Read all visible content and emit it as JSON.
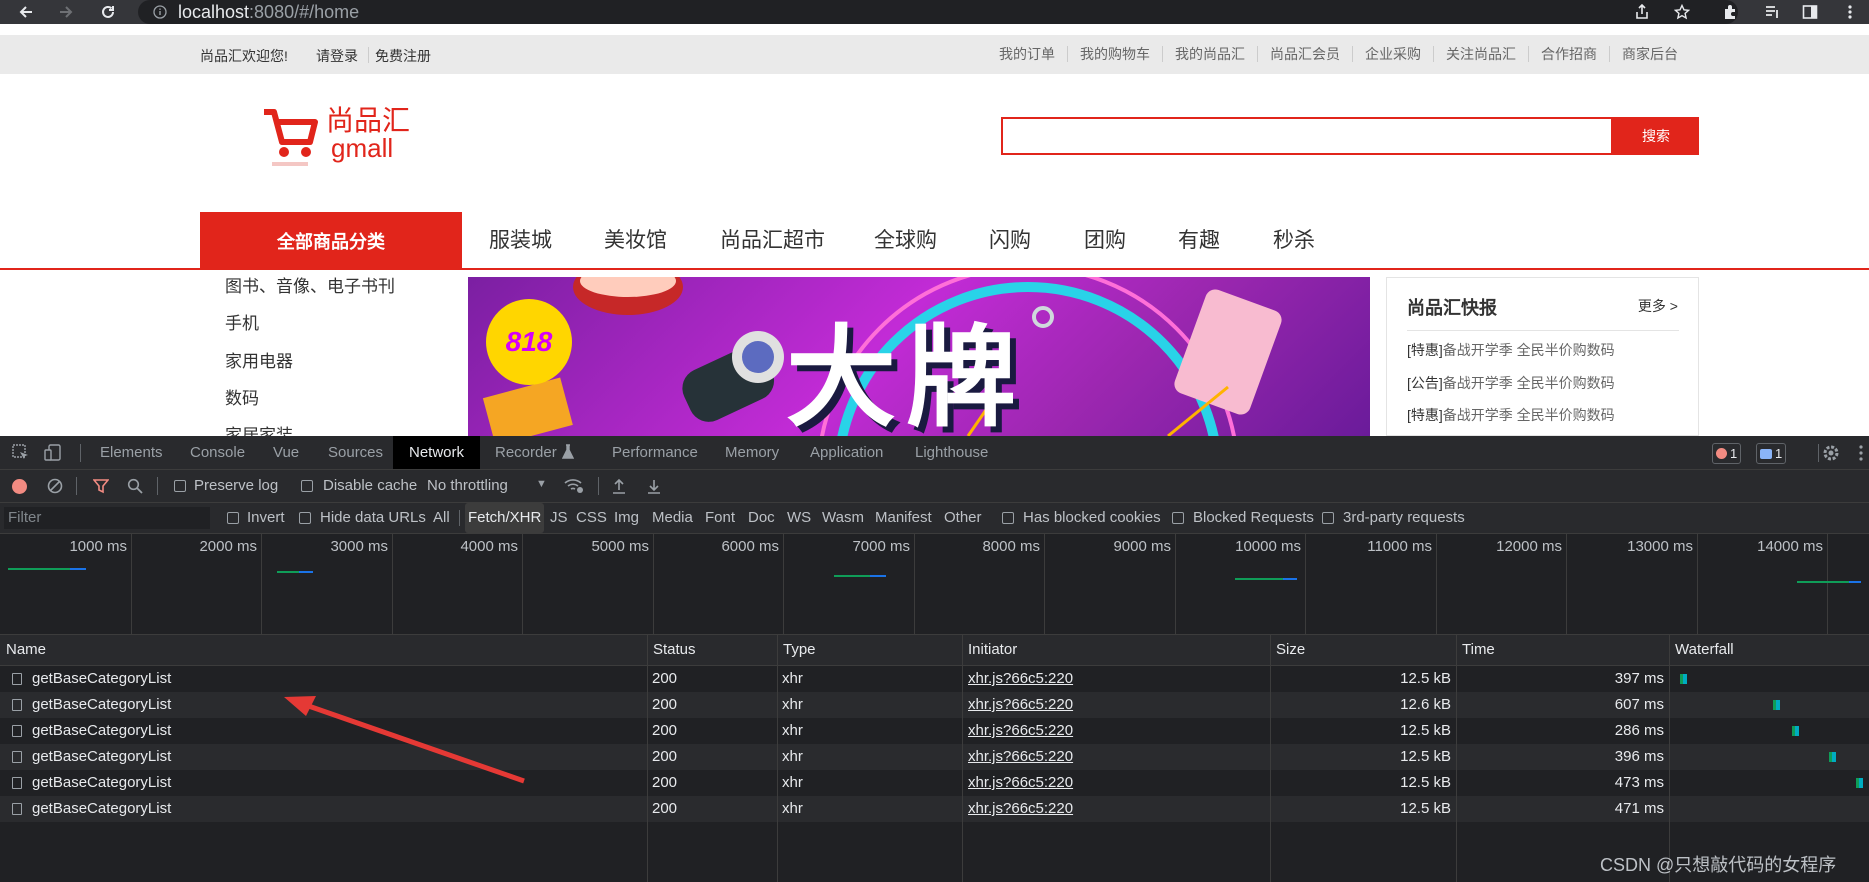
{
  "browser": {
    "url_host": "localhost",
    "url_rest": ":8080/#/home"
  },
  "site": {
    "welcome": "尚品汇欢迎您!",
    "login": "请登录",
    "register": "免费注册",
    "top_links": [
      "我的订单",
      "我的购物车",
      "我的尚品汇",
      "尚品汇会员",
      "企业采购",
      "关注尚品汇",
      "合作招商",
      "商家后台"
    ],
    "logo_cn": "尚品汇",
    "logo_en": "gmall",
    "search_button": "搜索",
    "all_categories": "全部商品分类",
    "nav": [
      "服装城",
      "美妆馆",
      "尚品汇超市",
      "全球购",
      "闪购",
      "团购",
      "有趣",
      "秒杀"
    ],
    "categories": [
      "图书、音像、电子书刊",
      "手机",
      "家用电器",
      "数码",
      "家居家装"
    ],
    "banner_text": "大牌",
    "banner_badge": "818",
    "news": {
      "title": "尚品汇快报",
      "more": "更多 >",
      "items": [
        {
          "tag": "[特惠]",
          "text": "备战开学季 全民半价购数码"
        },
        {
          "tag": "[公告]",
          "text": "备战开学季 全民半价购数码"
        },
        {
          "tag": "[特惠]",
          "text": "备战开学季 全民半价购数码"
        }
      ]
    }
  },
  "devtools": {
    "tabs": [
      "Elements",
      "Console",
      "Vue",
      "Sources",
      "Network",
      "Recorder",
      "Performance",
      "Memory",
      "Application",
      "Lighthouse"
    ],
    "active_tab": "Network",
    "error_count": "1",
    "message_count": "1",
    "toolbar": {
      "preserve_log": "Preserve log",
      "disable_cache": "Disable cache",
      "throttling": "No throttling"
    },
    "filter": {
      "placeholder": "Filter",
      "invert": "Invert",
      "hide_data_urls": "Hide data URLs",
      "types": [
        "All",
        "Fetch/XHR",
        "JS",
        "CSS",
        "Img",
        "Media",
        "Font",
        "Doc",
        "WS",
        "Wasm",
        "Manifest",
        "Other"
      ],
      "active_type": "Fetch/XHR",
      "has_blocked_cookies": "Has blocked cookies",
      "blocked_requests": "Blocked Requests",
      "third_party": "3rd-party requests"
    },
    "timeline_labels": [
      "1000 ms",
      "2000 ms",
      "3000 ms",
      "4000 ms",
      "5000 ms",
      "6000 ms",
      "7000 ms",
      "8000 ms",
      "9000 ms",
      "10000 ms",
      "11000 ms",
      "12000 ms",
      "13000 ms",
      "14000 ms"
    ],
    "columns": [
      "Name",
      "Status",
      "Type",
      "Initiator",
      "Size",
      "Time",
      "Waterfall"
    ],
    "requests": [
      {
        "name": "getBaseCategoryList",
        "status": "200",
        "type": "xhr",
        "initiator": "xhr.js?66c5:220",
        "size": "12.5 kB",
        "time": "397 ms"
      },
      {
        "name": "getBaseCategoryList",
        "status": "200",
        "type": "xhr",
        "initiator": "xhr.js?66c5:220",
        "size": "12.6 kB",
        "time": "607 ms"
      },
      {
        "name": "getBaseCategoryList",
        "status": "200",
        "type": "xhr",
        "initiator": "xhr.js?66c5:220",
        "size": "12.5 kB",
        "time": "286 ms"
      },
      {
        "name": "getBaseCategoryList",
        "status": "200",
        "type": "xhr",
        "initiator": "xhr.js?66c5:220",
        "size": "12.5 kB",
        "time": "396 ms"
      },
      {
        "name": "getBaseCategoryList",
        "status": "200",
        "type": "xhr",
        "initiator": "xhr.js?66c5:220",
        "size": "12.5 kB",
        "time": "473 ms"
      },
      {
        "name": "getBaseCategoryList",
        "status": "200",
        "type": "xhr",
        "initiator": "xhr.js?66c5:220",
        "size": "12.5 kB",
        "time": "471 ms"
      }
    ]
  },
  "watermark": "CSDN @只想敲代码的女程序",
  "colors": {
    "brand_red": "#e1251b",
    "devtools_bg": "#202124",
    "wf_green": "#0f9d58",
    "wf_blue": "#1a73e8"
  }
}
